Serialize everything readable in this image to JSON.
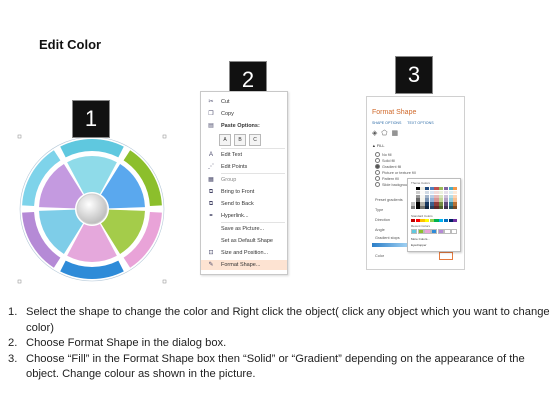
{
  "title": "Edit Color",
  "badges": [
    "1",
    "2",
    "3"
  ],
  "context_menu": {
    "items": [
      {
        "icon": "cut-icon",
        "glyph": "✂",
        "label": "Cut"
      },
      {
        "icon": "copy-icon",
        "glyph": "❐",
        "label": "Copy"
      },
      {
        "icon": "paste-icon",
        "glyph": "📋",
        "label": "Paste Options:",
        "bold": true
      },
      {
        "icon": "edit-text-icon",
        "glyph": "A",
        "label": "Edit Text"
      },
      {
        "icon": "edit-points-icon",
        "glyph": "⋰",
        "label": "Edit Points"
      },
      {
        "icon": "group-icon",
        "glyph": "▦",
        "label": "Group",
        "disabled": true
      },
      {
        "icon": "bring-to-front-icon",
        "glyph": "⧉",
        "label": "Bring to Front"
      },
      {
        "icon": "send-to-back-icon",
        "glyph": "⧉",
        "label": "Send to Back"
      },
      {
        "icon": "hyperlink-icon",
        "glyph": "🔗",
        "label": "Hyperlink..."
      },
      {
        "icon": "save-picture-icon",
        "glyph": "",
        "label": "Save as Picture..."
      },
      {
        "icon": "default-shape-icon",
        "glyph": "",
        "label": "Set as Default Shape"
      },
      {
        "icon": "size-position-icon",
        "glyph": "⊡",
        "label": "Size and Position..."
      },
      {
        "icon": "format-shape-icon",
        "glyph": "✎",
        "label": "Format Shape...",
        "highlight": true
      }
    ],
    "paste_icons": [
      "A",
      "B",
      "C"
    ]
  },
  "format_pane": {
    "title": "Format Shape",
    "tabs": [
      "SHAPE OPTIONS",
      "TEXT OPTIONS"
    ],
    "section": "FILL",
    "fill_options": [
      {
        "label": "No fill",
        "selected": false
      },
      {
        "label": "Solid fill",
        "selected": false
      },
      {
        "label": "Gradient fill",
        "selected": true
      },
      {
        "label": "Picture or texture fill",
        "selected": false
      },
      {
        "label": "Pattern fill",
        "selected": false
      },
      {
        "label": "Slide background fill",
        "selected": false
      }
    ],
    "labels": [
      "Preset gradients",
      "Type",
      "Direction",
      "Angle",
      "Gradient stops",
      "Color"
    ],
    "palette": {
      "theme_label": "Theme Colors",
      "standard_label": "Standard Colors",
      "recent_label": "Recent Colors",
      "more_colors": "More Colors...",
      "eyedropper": "Eyedropper"
    }
  },
  "instructions": [
    {
      "num": "1.",
      "text": "Select the shape to change the color and Right click the object( click any object which you want to change color)"
    },
    {
      "num": "2.",
      "text": "Choose Format Shape in the dialog box."
    },
    {
      "num": "3.",
      "text": "Choose “Fill” in the Format Shape box then “Solid” or “Gradient” depending on the appearance of the object. Change colour as shown in the picture."
    }
  ],
  "colors": {
    "donut_outer": [
      "#5fc8df",
      "#8cbf2c",
      "#e9a3d8",
      "#2e8bd8",
      "#b58ad6",
      "#7ed3ea"
    ],
    "donut_inner": [
      "#8fdbe9",
      "#5aa8ee",
      "#a4cc4a",
      "#e5a8dc",
      "#7ecde8",
      "#c49ae0"
    ],
    "highlight": "#fde3d2"
  }
}
